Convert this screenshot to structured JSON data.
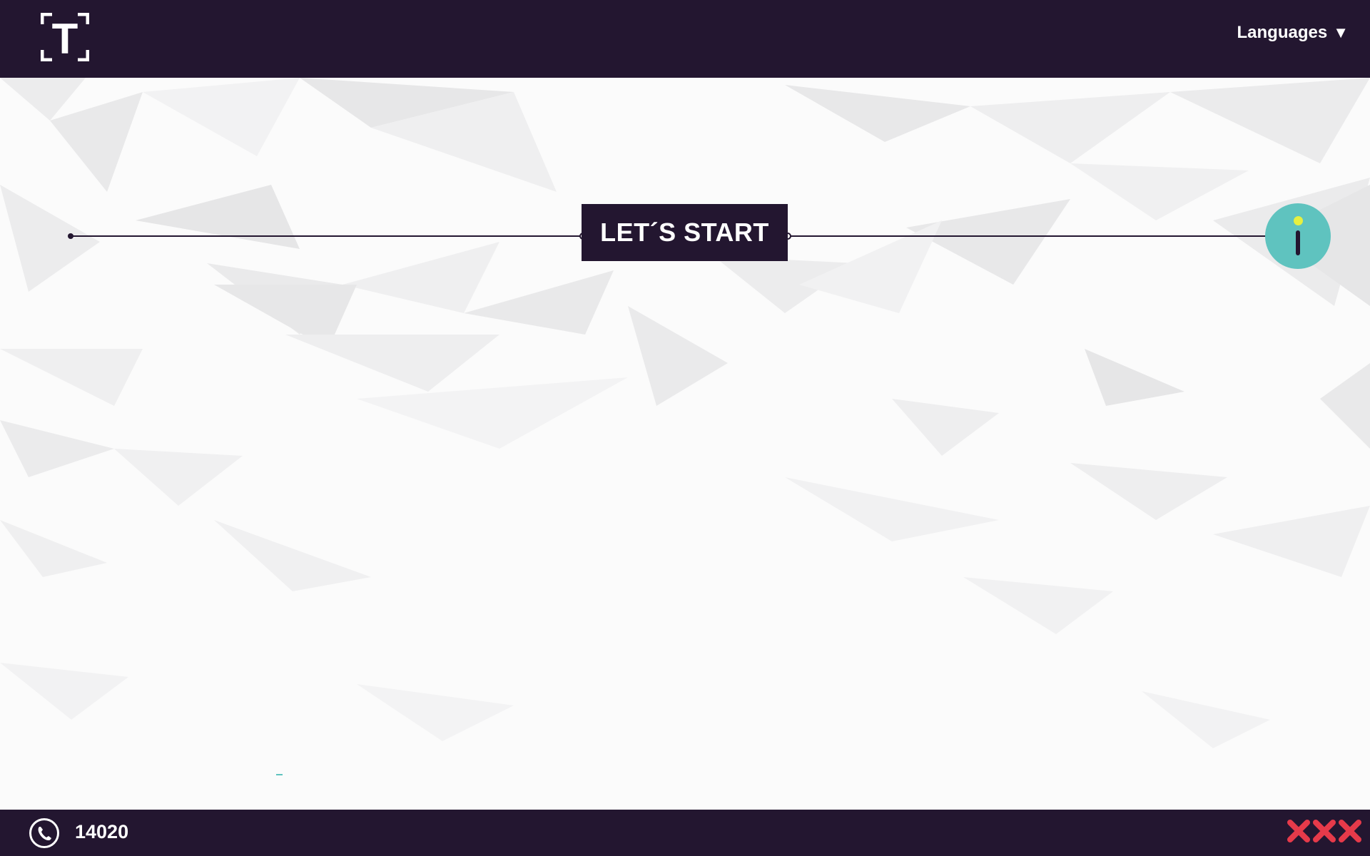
{
  "header": {
    "logo_letter": "T",
    "languages_label": "Languages",
    "languages_caret": "▼"
  },
  "main": {
    "title": "LET´S START"
  },
  "footer": {
    "phone_number": "14020"
  },
  "colors": {
    "dark": "#231630",
    "teal": "#5fc3bf",
    "yellow": "#e6f040",
    "red": "#e63a4a",
    "white": "#ffffff"
  },
  "icons": {
    "logo": "bracket-t-logo-icon",
    "languages": "caret-down-icon",
    "info": "info-icon",
    "phone": "phone-icon",
    "close": "close-icon"
  }
}
